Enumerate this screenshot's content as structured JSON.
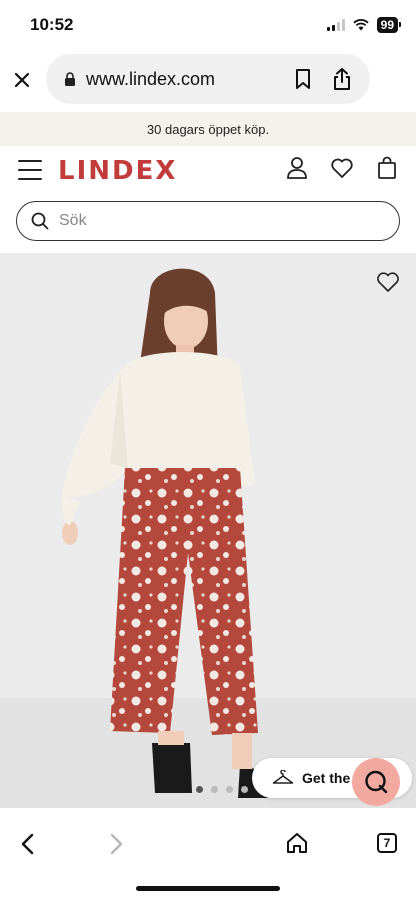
{
  "status": {
    "time": "10:52",
    "battery": "99"
  },
  "browser": {
    "url": "www.lindex.com",
    "tab_count": "7"
  },
  "promo": {
    "text": "30 dagars öppet köp."
  },
  "brand": {
    "logo_text": "LINDEX",
    "accent": "#c23b3b"
  },
  "search": {
    "placeholder": "Sök"
  },
  "product": {
    "carousel_dots": 4,
    "active_dot": 0
  },
  "get_app": {
    "label": "Get the "
  },
  "colors": {
    "chat_bubble": "#f2a9a0",
    "promo_bg": "#f5f1ec",
    "pants": "#b5483c"
  }
}
